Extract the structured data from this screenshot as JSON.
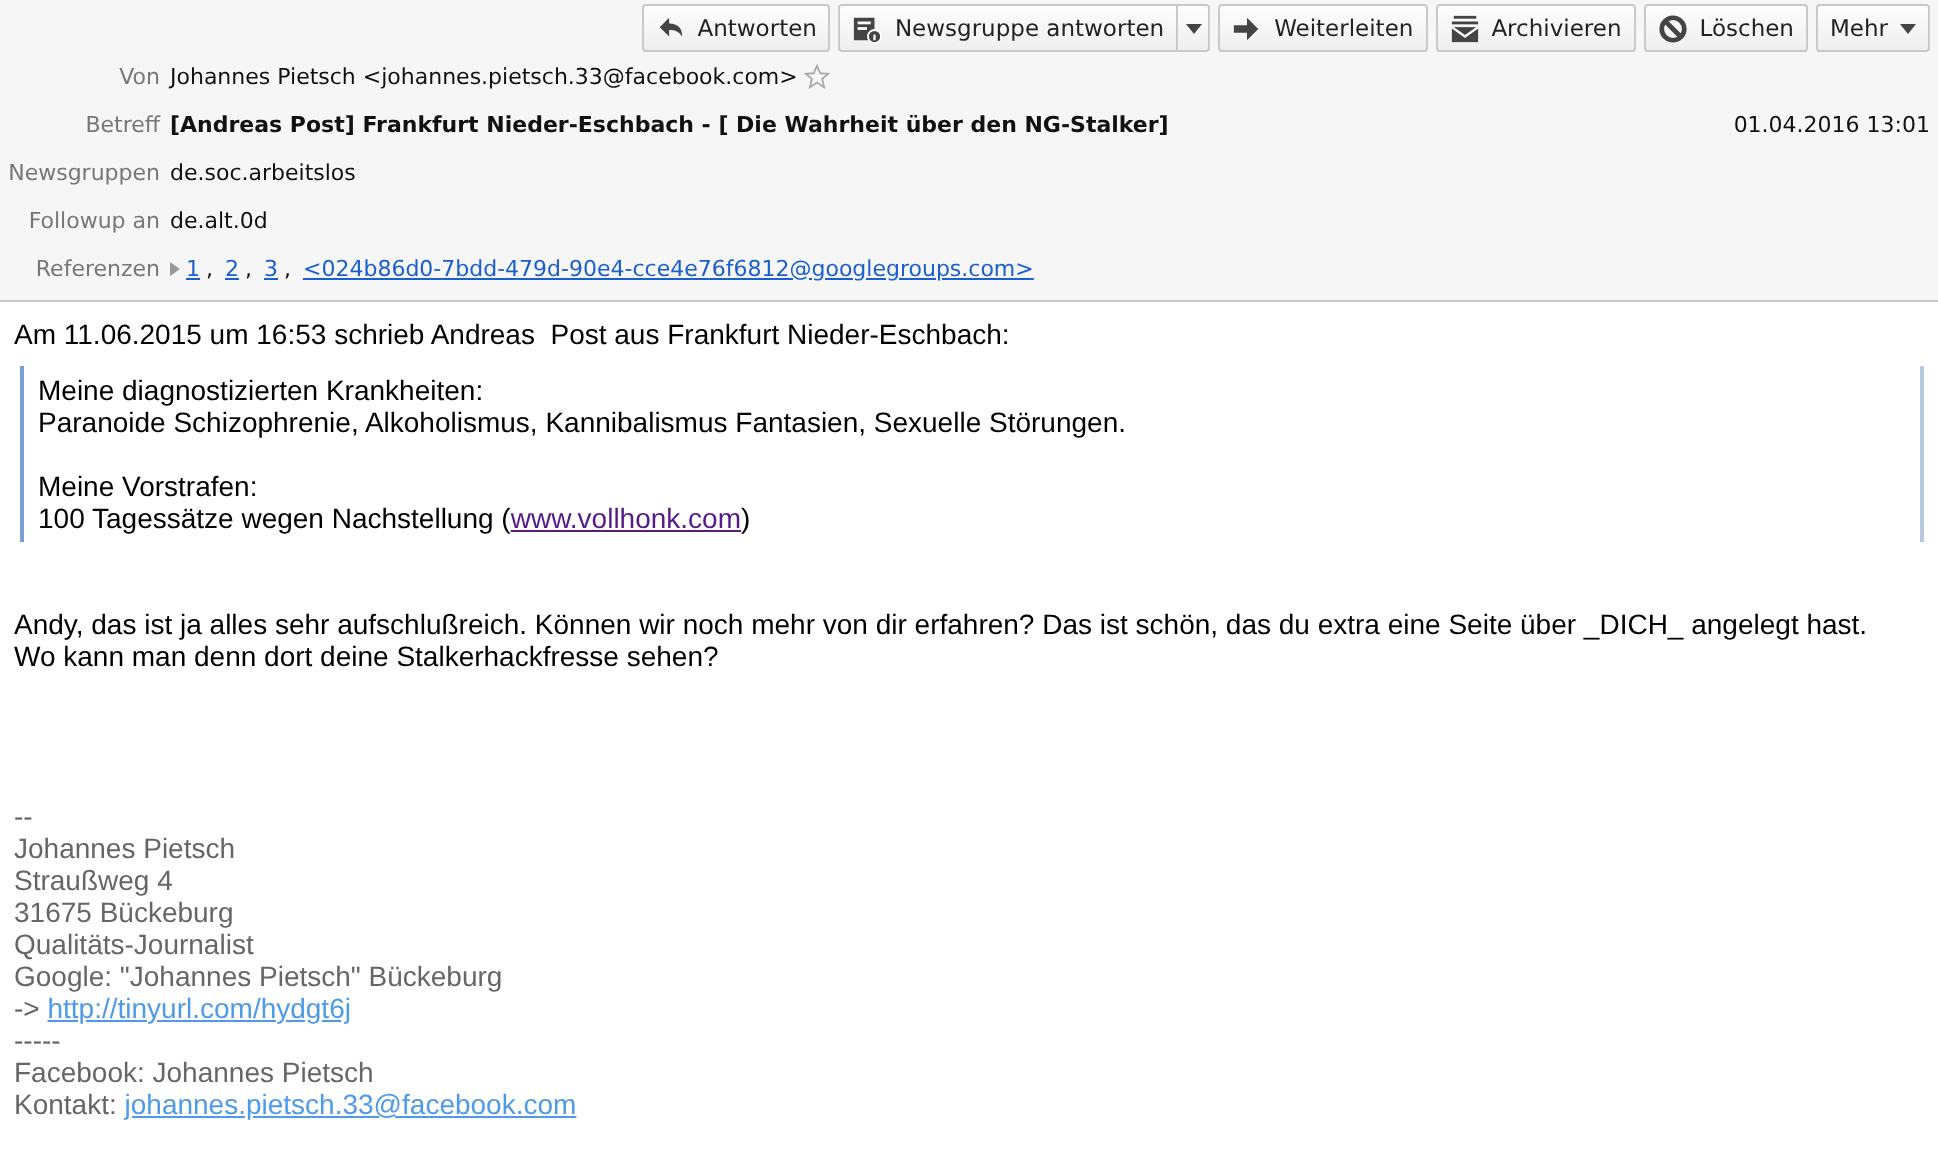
{
  "toolbar": {
    "buttons": [
      {
        "label": "Antworten",
        "kind": "plain"
      },
      {
        "label": "Newsgruppe antworten",
        "kind": "split"
      },
      {
        "label": "Weiterleiten",
        "kind": "plain"
      },
      {
        "label": "Archivieren",
        "kind": "plain"
      },
      {
        "label": "Löschen",
        "kind": "plain"
      },
      {
        "label": "Mehr",
        "kind": "menu"
      }
    ]
  },
  "header": {
    "from": {
      "label": "Von",
      "value": "Johannes Pietsch <johannes.pietsch.33@facebook.com>",
      "starred": false
    },
    "subject": {
      "label": "Betreff",
      "value": "[Andreas Post] Frankfurt Nieder-Eschbach - [ Die Wahrheit über den NG-Stalker]",
      "date": "01.04.2016 13:01"
    },
    "newsgroups": {
      "label": "Newsgruppen",
      "value": "de.soc.arbeitslos"
    },
    "followup": {
      "label": "Followup an",
      "value": "de.alt.0d"
    },
    "references": {
      "label": "Referenzen",
      "links": [
        {
          "text": "1",
          "separator": ","
        },
        {
          "text": "2",
          "separator": ","
        },
        {
          "text": "3",
          "separator": ","
        },
        {
          "text": "<024b86d0-7bdd-479d-90e4-cce4e76f6812@googlegroups.com>"
        }
      ]
    }
  },
  "body": {
    "intro": "Am 11.06.2015 um 16:53 schrieb Andreas  Post aus Frankfurt Nieder-Eschbach:",
    "quote": [
      {
        "lines": [
          {
            "text": "Meine diagnostizierten Krankheiten:"
          },
          {
            "text": "Paranoide Schizophrenie, Alkoholismus, Kannibalismus Fantasien, Sexuelle Störungen."
          }
        ]
      },
      {
        "lines": [
          {
            "text": "Meine Vorstrafen:"
          },
          {
            "text": "100 Tagessätze wegen Nachstellung (",
            "link": "www.vollhonk.com",
            "after": ")"
          }
        ]
      }
    ],
    "reply": [
      "Andy, das ist ja alles sehr aufschlußreich. Können wir noch mehr von dir erfahren? Das ist schön, das du extra eine Seite über _DICH_ angelegt hast.",
      "Wo kann man denn dort deine Stalkerhackfresse sehen?"
    ],
    "signature": [
      {
        "text": "--"
      },
      {
        "text": "Johannes Pietsch"
      },
      {
        "text": "Straußweg 4"
      },
      {
        "text": "31675 Bückeburg"
      },
      {
        "text": "Qualitäts-Journalist"
      },
      {
        "text": "Google: \"Johannes Pietsch\" Bückeburg"
      },
      {
        "text": "-> ",
        "link": "http://tinyurl.com/hydgt6j"
      },
      {
        "text": "-----"
      },
      {
        "text": "Facebook: Johannes Pietsch"
      },
      {
        "text": "Kontakt: ",
        "link": "johannes.pietsch.33@facebook.com"
      }
    ]
  }
}
